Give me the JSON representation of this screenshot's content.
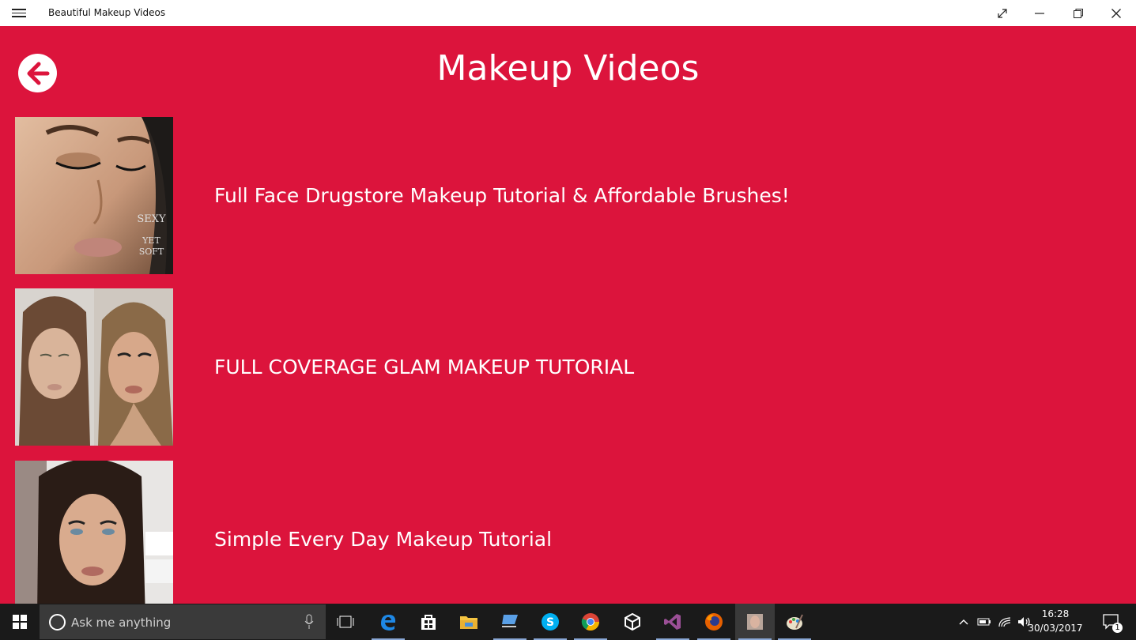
{
  "window": {
    "title": "Beautiful Makeup Videos",
    "menu_icon": "hamburger-icon",
    "controls": [
      "fullscreen-icon",
      "minimize-icon",
      "restore-icon",
      "close-icon"
    ]
  },
  "page": {
    "title": "Makeup Videos",
    "back_icon": "arrow-left-icon",
    "accent_color": "#dc143c"
  },
  "videos": [
    {
      "title": "Full Face Drugstore Makeup Tutorial & Affordable Brushes!",
      "thumb_text_1": "SEXY",
      "thumb_text_2": "YET SOFT"
    },
    {
      "title": "FULL COVERAGE GLAM MAKEUP TUTORIAL"
    },
    {
      "title": "Simple Every Day Makeup Tutorial"
    }
  ],
  "taskbar": {
    "search_placeholder": "Ask me anything",
    "apps": [
      "task-view-icon",
      "edge-icon",
      "store-icon",
      "file-explorer-icon",
      "remote-desktop-icon",
      "skype-icon",
      "chrome-icon",
      "unity-icon",
      "visual-studio-icon",
      "firefox-icon",
      "makeup-app-icon",
      "paint-icon"
    ],
    "time": "16:28",
    "date": "30/03/2017",
    "notification_count": "1"
  }
}
